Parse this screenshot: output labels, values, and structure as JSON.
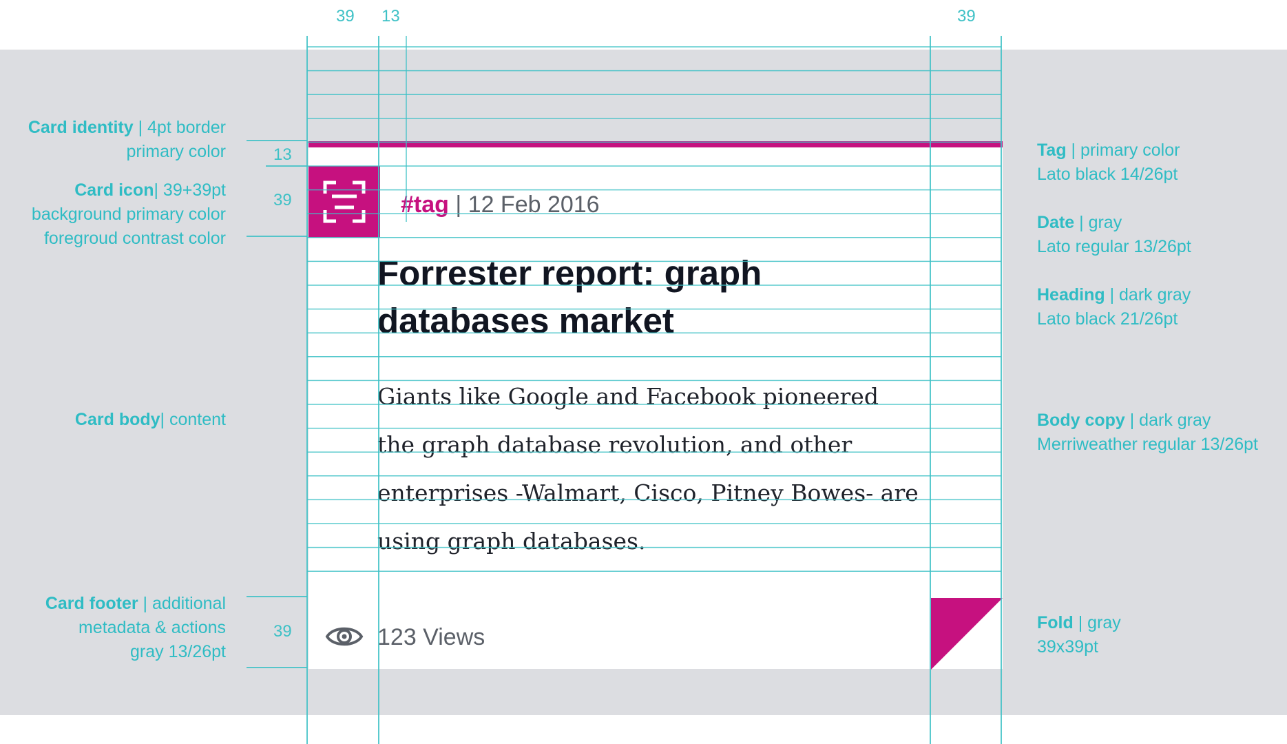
{
  "measures": {
    "top_a": "39",
    "top_b": "13",
    "top_c": "39",
    "side_13": "13",
    "side_39_icon": "39",
    "side_39_footer": "39"
  },
  "card": {
    "tag": "#tag",
    "separator": " | ",
    "date": "12 Feb 2016",
    "heading": "Forrester report: graph databases market",
    "body": "Giants like Google and Facebook pioneered the graph database revolution, and other enterprises -Walmart, Cisco, Pitney Bowes- are using graph databases.",
    "views": "123 Views",
    "icon": "scan-icon",
    "footer_icon": "eye-icon"
  },
  "annotations": {
    "left": [
      {
        "title": "Card identity",
        "rest": " | 4pt border",
        "line2": "primary color",
        "line3": ""
      },
      {
        "title": "Card icon",
        "rest": "| 39+39pt",
        "line2": "background primary color",
        "line3": "foregroud contrast color"
      },
      {
        "title": "Card body",
        "rest": "| content",
        "line2": "",
        "line3": ""
      },
      {
        "title": "Card footer",
        "rest": " | additional",
        "line2": "metadata & actions",
        "line3": "gray 13/26pt"
      }
    ],
    "right": [
      {
        "title": "Tag",
        "rest": " | primary color",
        "line2": "Lato black 14/26pt"
      },
      {
        "title": "Date",
        "rest": " | gray",
        "line2": "Lato regular 13/26pt"
      },
      {
        "title": "Heading",
        "rest": " | dark gray",
        "line2": "Lato black 21/26pt"
      },
      {
        "title": "Body copy",
        "rest": " | dark gray",
        "line2": "Merriweather regular 13/26pt"
      },
      {
        "title": "Fold",
        "rest": " | gray",
        "line2": "39x39pt"
      }
    ]
  },
  "colors": {
    "primary": "#c6117f",
    "guide": "#3ec1c6",
    "band": "#dcdde1",
    "dark": "#111521",
    "gray": "#5b6068"
  }
}
